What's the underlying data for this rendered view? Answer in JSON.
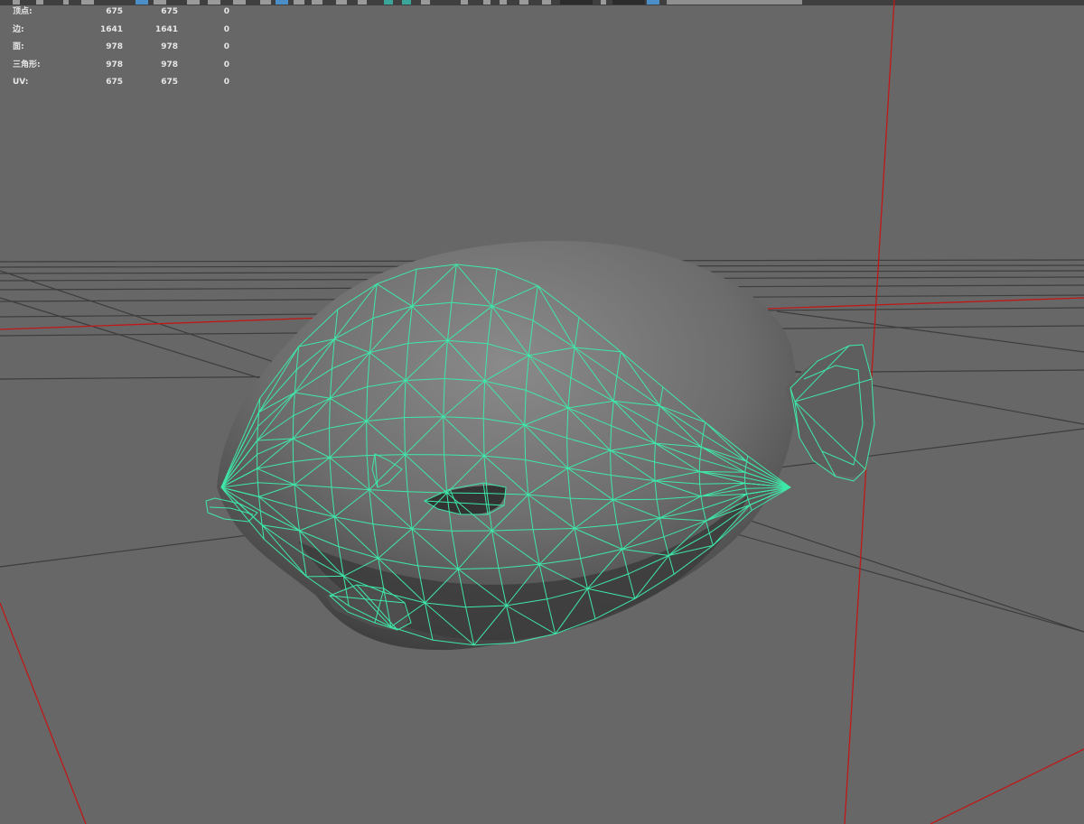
{
  "toolbar": {
    "camera_readout": "",
    "truncated_text": ""
  },
  "hud": {
    "rows": [
      {
        "label": "顶点:",
        "visible": "675",
        "selected": "675",
        "extra": "0"
      },
      {
        "label": "边:",
        "visible": "1641",
        "selected": "1641",
        "extra": "0"
      },
      {
        "label": "面:",
        "visible": "978",
        "selected": "978",
        "extra": "0"
      },
      {
        "label": "三角形:",
        "visible": "978",
        "selected": "978",
        "extra": "0"
      },
      {
        "label": "UV:",
        "visible": "675",
        "selected": "675",
        "extra": "0"
      }
    ]
  },
  "colors": {
    "background": "#676767",
    "wireframe": "#3ee8a8",
    "axis": "#c01818",
    "grid": "#3a3a3a"
  },
  "viewport": {
    "object": "fish-mesh-wireframe",
    "mode": "wireframe-on-shaded"
  }
}
